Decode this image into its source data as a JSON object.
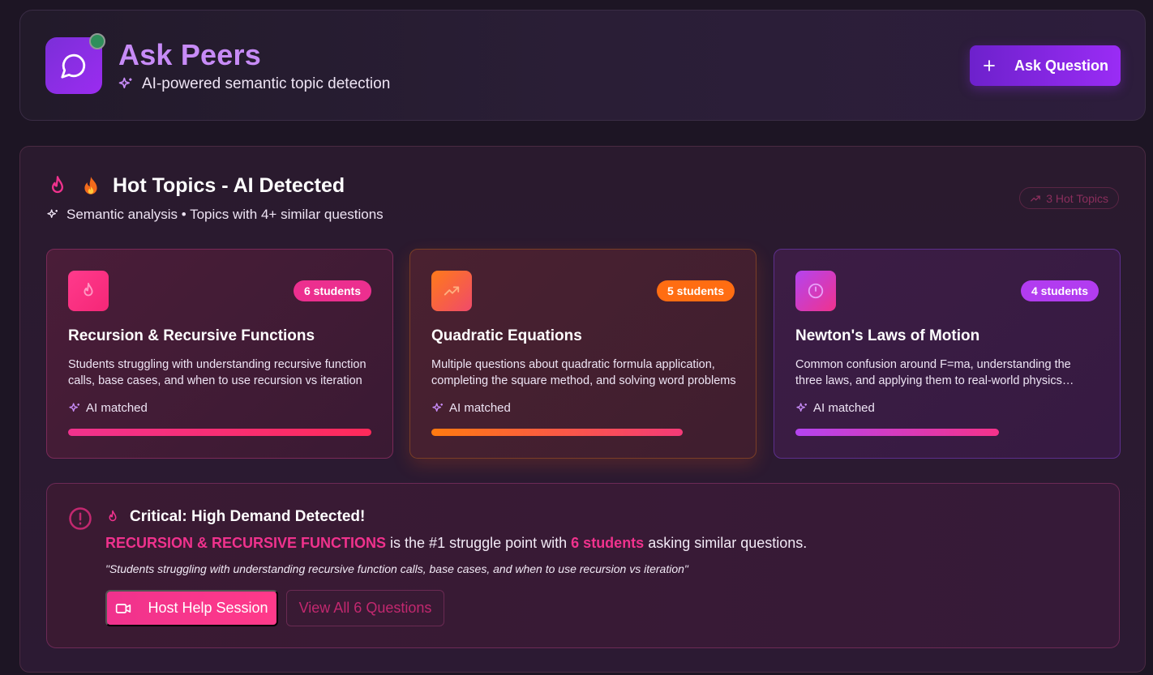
{
  "header": {
    "title": "Ask Peers",
    "subtitle": "AI-powered semantic topic detection",
    "ask_button": "Ask Question",
    "logo_icon": "chat-bubble-icon"
  },
  "hot_topics": {
    "title": "Hot Topics - AI Detected",
    "subtitle": "Semantic analysis • Topics with 4+ similar questions",
    "count_label": "3 Hot Topics",
    "cards": [
      {
        "students": "6 students",
        "title": "Recursion & Recursive Functions",
        "description": "Students struggling with understanding recursive function calls, base cases, and when to use recursion vs iteration",
        "ai_label": "AI matched",
        "progress": 1.0,
        "icon": "flame-icon"
      },
      {
        "students": "5 students",
        "title": "Quadratic Equations",
        "description": "Multiple questions about quadratic formula application, completing the square method, and solving word problems",
        "ai_label": "AI matched",
        "progress": 0.83,
        "icon": "trending-up-icon"
      },
      {
        "students": "4 students",
        "title": "Newton's Laws of Motion",
        "description": "Common confusion around F=ma, understanding the three laws, and applying them to real-world physics problems",
        "ai_label": "AI matched",
        "progress": 0.67,
        "icon": "clock-icon"
      }
    ]
  },
  "alert": {
    "title": "Critical: High Demand Detected!",
    "topic": "RECURSION & RECURSIVE FUNCTIONS",
    "middle": " is the #1 struggle point with ",
    "students": "6 students",
    "end": " asking similar questions.",
    "quote": "\"Students struggling with understanding recursive function calls, base cases, and when to use recursion vs iteration\"",
    "host_button": "Host Help Session",
    "view_button": "View All 6 Questions"
  },
  "colors": {
    "accent_purple": "#9a2cf5",
    "accent_pink": "#f0328d",
    "accent_orange": "#ff6d12"
  }
}
